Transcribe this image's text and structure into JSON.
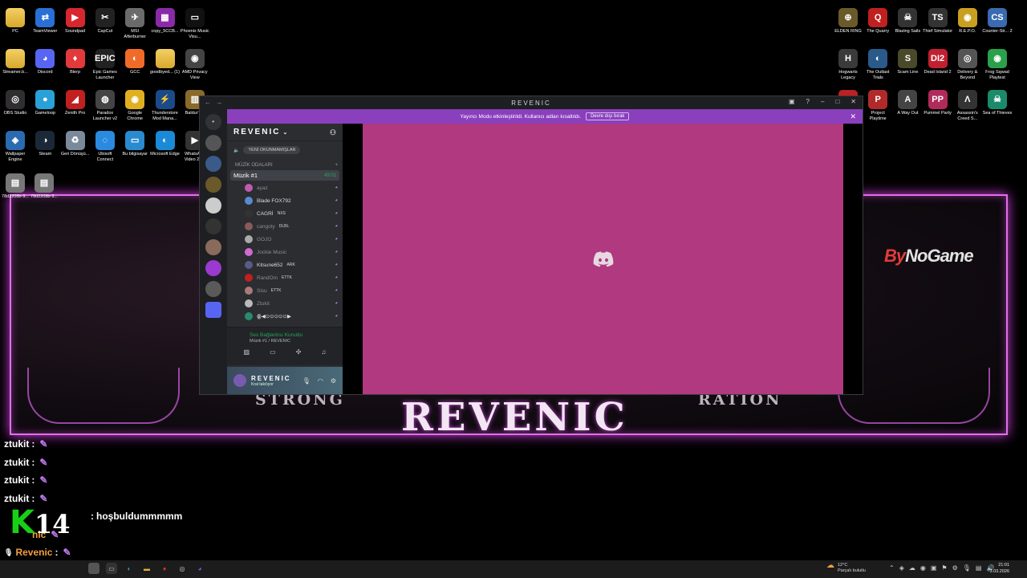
{
  "desktop": {
    "left_icons": [
      {
        "label": "PC",
        "glyph": "",
        "color": "#e8b84a",
        "type": "folder"
      },
      {
        "label": "TeamViewer",
        "glyph": "⇄",
        "color": "#2a6fd6"
      },
      {
        "label": "Soundpad",
        "glyph": "▶",
        "color": "#d8262e"
      },
      {
        "label": "CapCut",
        "glyph": "✂",
        "color": "#222222"
      },
      {
        "label": "MSI Afterburner",
        "glyph": "✈",
        "color": "#6b6b6b"
      },
      {
        "label": "copy_5CCB...",
        "glyph": "▦",
        "color": "#8a2aa8"
      },
      {
        "label": "Phoenix Music Visu...",
        "glyph": "▭",
        "color": "#111111"
      },
      {
        "label": "Streamer.b...",
        "glyph": "",
        "color": "#e8b84a",
        "type": "folder"
      },
      {
        "label": "Discord",
        "glyph": "◕",
        "color": "#5865f2"
      },
      {
        "label": "Blerp",
        "glyph": "♦",
        "color": "#e23a3a"
      },
      {
        "label": "Epic Games Launcher",
        "glyph": "EPIC",
        "color": "#222222"
      },
      {
        "label": "GCC",
        "glyph": "◐",
        "color": "#f06a2a"
      },
      {
        "label": "goodbyed... (1)",
        "glyph": "",
        "color": "#e8b84a",
        "type": "folder"
      },
      {
        "label": "AMD Privacy View",
        "glyph": "◉",
        "color": "#444444"
      },
      {
        "label": "OBS Studio",
        "glyph": "◎",
        "color": "#302e31"
      },
      {
        "label": "Gameloop",
        "glyph": "●",
        "color": "#2aa0d8"
      },
      {
        "label": "Zenith Pro",
        "glyph": "◢",
        "color": "#c02020"
      },
      {
        "label": "Paradox Launcher v2",
        "glyph": "◍",
        "color": "#444444"
      },
      {
        "label": "Google Chrome",
        "glyph": "◉",
        "color": "#e0b020"
      },
      {
        "label": "Thunderstore Mod Mana...",
        "glyph": "⚡",
        "color": "#1a4a8a"
      },
      {
        "label": "Baldur's...",
        "glyph": "▥",
        "color": "#8a6a2a"
      },
      {
        "label": "Wallpaper Engine",
        "glyph": "◈",
        "color": "#2a6ab0"
      },
      {
        "label": "Steam",
        "glyph": "◑",
        "color": "#1b2838"
      },
      {
        "label": "Geri Dönüşü...",
        "glyph": "♻",
        "color": "#7a8a9a"
      },
      {
        "label": "Ubisoft Connect",
        "glyph": "◌",
        "color": "#2a8ae0"
      },
      {
        "label": "Bu bilgisayar",
        "glyph": "▭",
        "color": "#2a8ad0"
      },
      {
        "label": "Microsoft Edge",
        "glyph": "◐",
        "color": "#1a8ad8"
      },
      {
        "label": "WhatsApp Video 20...",
        "glyph": "▶",
        "color": "#333333"
      },
      {
        "label": "78d2208b-9...",
        "glyph": "▤",
        "color": "#777777"
      },
      {
        "label": "78d2208b-9...",
        "glyph": "▤",
        "color": "#777777"
      }
    ],
    "right_icons": [
      {
        "label": "ELDEN RING",
        "glyph": "⊕",
        "color": "#6a5a2a"
      },
      {
        "label": "The Quarry",
        "glyph": "Q",
        "color": "#c02020"
      },
      {
        "label": "Blazing Sails",
        "glyph": "☠",
        "color": "#333333"
      },
      {
        "label": "Thief Simulator",
        "glyph": "TS",
        "color": "#333333"
      },
      {
        "label": "R.E.P.O.",
        "glyph": "◉",
        "color": "#c8a020"
      },
      {
        "label": "Counter-Str... 2",
        "glyph": "CS",
        "color": "#3a6ab0"
      },
      {
        "label": "Hogwarts Legacy",
        "glyph": "H",
        "color": "#3a3a3a"
      },
      {
        "label": "The Outlast Trials",
        "glyph": "◐",
        "color": "#2a5a8a"
      },
      {
        "label": "Scam Line",
        "glyph": "S",
        "color": "#4a4a2a"
      },
      {
        "label": "Dead Island 2",
        "glyph": "DI2",
        "color": "#c02030"
      },
      {
        "label": "Delivery & Beyond",
        "glyph": "◎",
        "color": "#555555"
      },
      {
        "label": "Frog Sqwad Playtest",
        "glyph": "◉",
        "color": "#2aa04a"
      },
      {
        "label": "Feign",
        "glyph": "●",
        "color": "#c02020"
      },
      {
        "label": "Project Playtime",
        "glyph": "P",
        "color": "#b02a2a"
      },
      {
        "label": "A Way Out",
        "glyph": "A",
        "color": "#444444"
      },
      {
        "label": "Pummel Party",
        "glyph": "PP",
        "color": "#b02a5a"
      },
      {
        "label": "Assassin's Creed S...",
        "glyph": "Λ",
        "color": "#333333"
      },
      {
        "label": "Sea of Thieves",
        "glyph": "☠",
        "color": "#1a8a6a"
      }
    ]
  },
  "overlay": {
    "title": "REVENIC",
    "sub_left": "STRONG",
    "sub_right": "RATION",
    "sponsor_prefix": "By",
    "sponsor_main": "NoGame"
  },
  "discord": {
    "window_title": "REVENIC",
    "streamer_banner": "Yayıncı Modu etkinleştirildi. Kullanıcı adları kısaltıldı.",
    "banner_button": "Devre dışı bırak",
    "server_name": "REVENIC",
    "unread_pill": "YENİ OKUNMAMIŞLAR",
    "category": "MÜZİK ODALARI",
    "channel": {
      "name": "Müzik #1",
      "time": "49:01"
    },
    "users": [
      {
        "name": "ayaz",
        "tag": "",
        "dim": true,
        "color": "#c05ab0"
      },
      {
        "name": "Blade FOX792",
        "tag": "",
        "dim": false,
        "color": "#5a8ad0"
      },
      {
        "name": "CAGRİ",
        "tag": "NXS",
        "dim": false,
        "color": "#333333"
      },
      {
        "name": "cangoty",
        "tag": "DLBL",
        "dim": true,
        "color": "#8a5a5a"
      },
      {
        "name": "GOJO",
        "tag": "",
        "dim": true,
        "color": "#aaaaaa"
      },
      {
        "name": "Jockie Music",
        "tag": "",
        "dim": true,
        "color": "#d06ad0"
      },
      {
        "name": "Kitsune652",
        "tag": "ARK",
        "dim": false,
        "color": "#5a5a8a"
      },
      {
        "name": "RandOm",
        "tag": "ETTK",
        "dim": true,
        "color": "#c02020"
      },
      {
        "name": "Sisu",
        "tag": "ETTK",
        "dim": true,
        "color": "#aa7a7a"
      },
      {
        "name": "Ztukit",
        "tag": "",
        "dim": true,
        "color": "#bbbbbb"
      },
      {
        "name": "ꙮ◀⊙⊙⊙⊙⊙▶",
        "tag": "",
        "dim": false,
        "color": "#2a8a6a"
      }
    ],
    "voice_status": "Ses Bağlantısı Kuruldu",
    "voice_channel": "Müzik #1 / REVENIC",
    "username": "REVENIC",
    "user_status": "Kral takılıyor"
  },
  "chat": [
    {
      "user": "ztukit",
      "msg": ""
    },
    {
      "user": "ztukit",
      "msg": ""
    },
    {
      "user": "ztukit",
      "msg": ""
    },
    {
      "user": "ztukit",
      "msg": ""
    },
    {
      "user": "",
      "msg": "hoşbuldummmmm"
    },
    {
      "user": "nic",
      "msg": ""
    },
    {
      "user": "Revenic",
      "msg": ""
    },
    {
      "user": "Revenic",
      "msg": ""
    }
  ],
  "watermark": {
    "letter": "K",
    "number": "14"
  },
  "taskbar": {
    "temperature": "12°C",
    "weather": "Parçalı bulutlu",
    "time": "21:01",
    "date": "3.03.2026"
  }
}
